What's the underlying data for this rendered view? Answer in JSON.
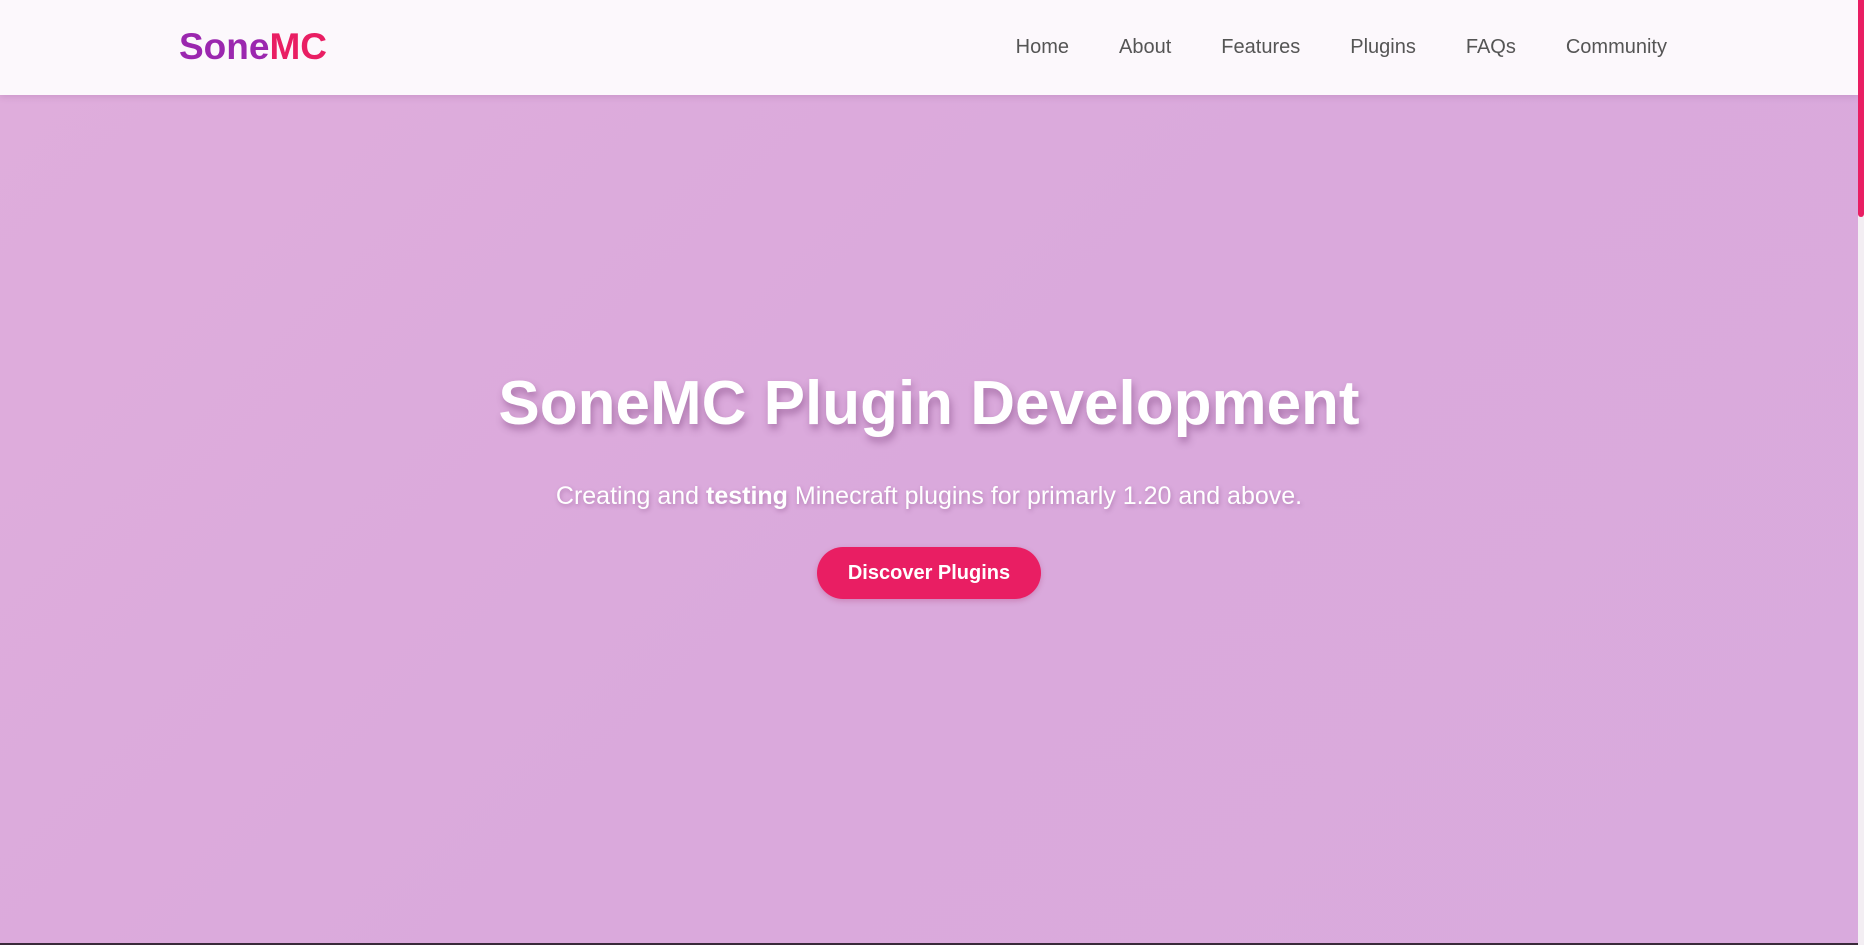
{
  "brand": {
    "part1": "Sone",
    "part2": "MC",
    "color1": "#9b27af",
    "color2": "#e91e63"
  },
  "nav": {
    "items": [
      {
        "label": "Home"
      },
      {
        "label": "About"
      },
      {
        "label": "Features"
      },
      {
        "label": "Plugins"
      },
      {
        "label": "FAQs"
      },
      {
        "label": "Community"
      }
    ]
  },
  "hero": {
    "title": "SoneMC Plugin Development",
    "subtitle_before": "Creating and ",
    "subtitle_bold": "testing",
    "subtitle_after": " Minecraft plugins for primarly 1.20 and above.",
    "cta_label": "Discover Plugins",
    "background": "#dcaadb",
    "accent": "#e91e63"
  }
}
